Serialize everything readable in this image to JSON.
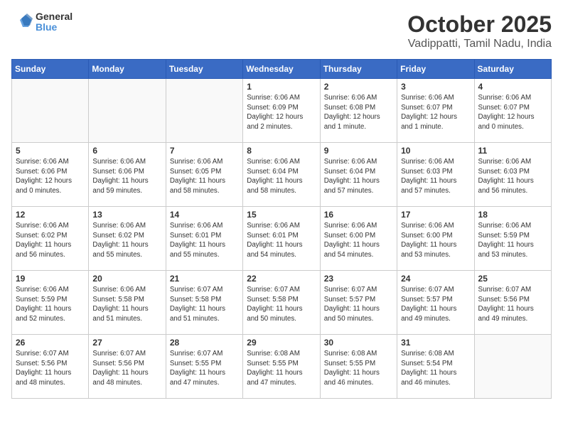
{
  "header": {
    "logo_general": "General",
    "logo_blue": "Blue",
    "month": "October 2025",
    "location": "Vadippatti, Tamil Nadu, India"
  },
  "weekdays": [
    "Sunday",
    "Monday",
    "Tuesday",
    "Wednesday",
    "Thursday",
    "Friday",
    "Saturday"
  ],
  "weeks": [
    [
      {
        "day": "",
        "empty": true
      },
      {
        "day": "",
        "empty": true
      },
      {
        "day": "",
        "empty": true
      },
      {
        "day": "1",
        "info": "Sunrise: 6:06 AM\nSunset: 6:09 PM\nDaylight: 12 hours\nand 2 minutes."
      },
      {
        "day": "2",
        "info": "Sunrise: 6:06 AM\nSunset: 6:08 PM\nDaylight: 12 hours\nand 1 minute."
      },
      {
        "day": "3",
        "info": "Sunrise: 6:06 AM\nSunset: 6:07 PM\nDaylight: 12 hours\nand 1 minute."
      },
      {
        "day": "4",
        "info": "Sunrise: 6:06 AM\nSunset: 6:07 PM\nDaylight: 12 hours\nand 0 minutes."
      }
    ],
    [
      {
        "day": "5",
        "info": "Sunrise: 6:06 AM\nSunset: 6:06 PM\nDaylight: 12 hours\nand 0 minutes."
      },
      {
        "day": "6",
        "info": "Sunrise: 6:06 AM\nSunset: 6:06 PM\nDaylight: 11 hours\nand 59 minutes."
      },
      {
        "day": "7",
        "info": "Sunrise: 6:06 AM\nSunset: 6:05 PM\nDaylight: 11 hours\nand 58 minutes."
      },
      {
        "day": "8",
        "info": "Sunrise: 6:06 AM\nSunset: 6:04 PM\nDaylight: 11 hours\nand 58 minutes."
      },
      {
        "day": "9",
        "info": "Sunrise: 6:06 AM\nSunset: 6:04 PM\nDaylight: 11 hours\nand 57 minutes."
      },
      {
        "day": "10",
        "info": "Sunrise: 6:06 AM\nSunset: 6:03 PM\nDaylight: 11 hours\nand 57 minutes."
      },
      {
        "day": "11",
        "info": "Sunrise: 6:06 AM\nSunset: 6:03 PM\nDaylight: 11 hours\nand 56 minutes."
      }
    ],
    [
      {
        "day": "12",
        "info": "Sunrise: 6:06 AM\nSunset: 6:02 PM\nDaylight: 11 hours\nand 56 minutes."
      },
      {
        "day": "13",
        "info": "Sunrise: 6:06 AM\nSunset: 6:02 PM\nDaylight: 11 hours\nand 55 minutes."
      },
      {
        "day": "14",
        "info": "Sunrise: 6:06 AM\nSunset: 6:01 PM\nDaylight: 11 hours\nand 55 minutes."
      },
      {
        "day": "15",
        "info": "Sunrise: 6:06 AM\nSunset: 6:01 PM\nDaylight: 11 hours\nand 54 minutes."
      },
      {
        "day": "16",
        "info": "Sunrise: 6:06 AM\nSunset: 6:00 PM\nDaylight: 11 hours\nand 54 minutes."
      },
      {
        "day": "17",
        "info": "Sunrise: 6:06 AM\nSunset: 6:00 PM\nDaylight: 11 hours\nand 53 minutes."
      },
      {
        "day": "18",
        "info": "Sunrise: 6:06 AM\nSunset: 5:59 PM\nDaylight: 11 hours\nand 53 minutes."
      }
    ],
    [
      {
        "day": "19",
        "info": "Sunrise: 6:06 AM\nSunset: 5:59 PM\nDaylight: 11 hours\nand 52 minutes."
      },
      {
        "day": "20",
        "info": "Sunrise: 6:06 AM\nSunset: 5:58 PM\nDaylight: 11 hours\nand 51 minutes."
      },
      {
        "day": "21",
        "info": "Sunrise: 6:07 AM\nSunset: 5:58 PM\nDaylight: 11 hours\nand 51 minutes."
      },
      {
        "day": "22",
        "info": "Sunrise: 6:07 AM\nSunset: 5:58 PM\nDaylight: 11 hours\nand 50 minutes."
      },
      {
        "day": "23",
        "info": "Sunrise: 6:07 AM\nSunset: 5:57 PM\nDaylight: 11 hours\nand 50 minutes."
      },
      {
        "day": "24",
        "info": "Sunrise: 6:07 AM\nSunset: 5:57 PM\nDaylight: 11 hours\nand 49 minutes."
      },
      {
        "day": "25",
        "info": "Sunrise: 6:07 AM\nSunset: 5:56 PM\nDaylight: 11 hours\nand 49 minutes."
      }
    ],
    [
      {
        "day": "26",
        "info": "Sunrise: 6:07 AM\nSunset: 5:56 PM\nDaylight: 11 hours\nand 48 minutes."
      },
      {
        "day": "27",
        "info": "Sunrise: 6:07 AM\nSunset: 5:56 PM\nDaylight: 11 hours\nand 48 minutes."
      },
      {
        "day": "28",
        "info": "Sunrise: 6:07 AM\nSunset: 5:55 PM\nDaylight: 11 hours\nand 47 minutes."
      },
      {
        "day": "29",
        "info": "Sunrise: 6:08 AM\nSunset: 5:55 PM\nDaylight: 11 hours\nand 47 minutes."
      },
      {
        "day": "30",
        "info": "Sunrise: 6:08 AM\nSunset: 5:55 PM\nDaylight: 11 hours\nand 46 minutes."
      },
      {
        "day": "31",
        "info": "Sunrise: 6:08 AM\nSunset: 5:54 PM\nDaylight: 11 hours\nand 46 minutes."
      },
      {
        "day": "",
        "empty": true
      }
    ]
  ]
}
